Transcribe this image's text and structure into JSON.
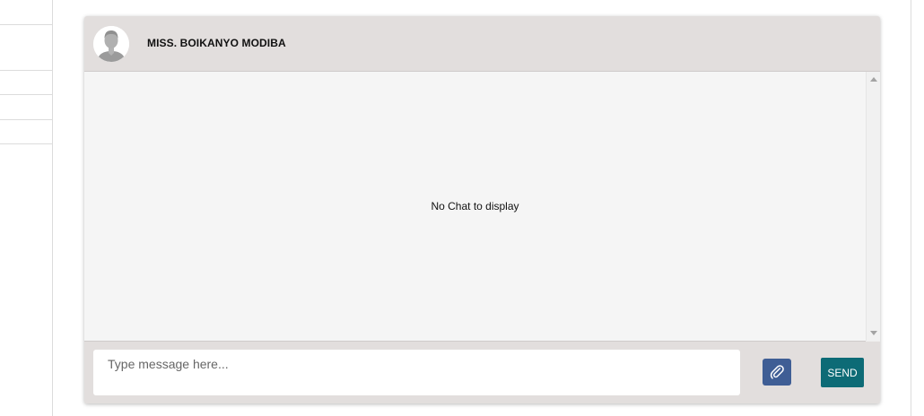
{
  "contact": {
    "name": "MISS. BOIKANYO MODIBA",
    "avatar_icon": "user-silhouette-icon"
  },
  "chat": {
    "empty_message": "No Chat to display"
  },
  "composer": {
    "placeholder": "Type message here...",
    "value": "",
    "attach_icon": "paperclip-icon",
    "send_label": "SEND"
  },
  "colors": {
    "header_bg": "#e2dedd",
    "body_bg": "#f5f5f5",
    "attach_button": "#3f5e95",
    "send_button": "#0d6b76"
  }
}
